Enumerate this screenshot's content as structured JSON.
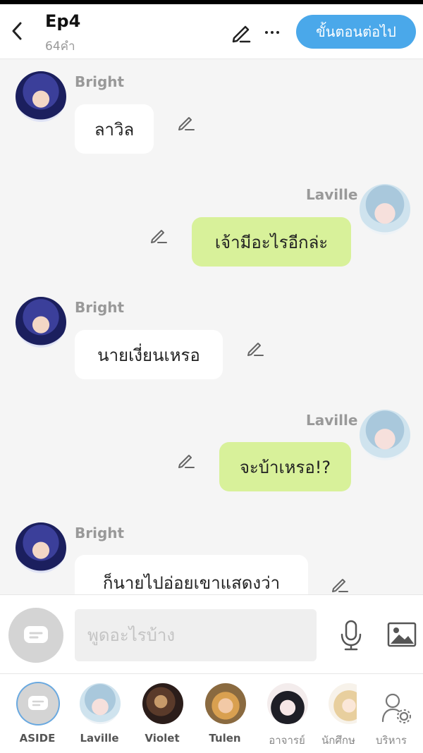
{
  "header": {
    "title": "Ep4",
    "word_count": "64คำ",
    "next_label": "ขั้นตอนต่อไป"
  },
  "messages": [
    {
      "side": "left",
      "sender": "Bright",
      "text": "ลาวิล"
    },
    {
      "side": "right",
      "sender": "Laville",
      "text": "เจ้ามีอะไรอีกล่ะ"
    },
    {
      "side": "left",
      "sender": "Bright",
      "text": "นายเงี่ยนเหรอ"
    },
    {
      "side": "right",
      "sender": "Laville",
      "text": "จะบ้าเหรอ!?"
    },
    {
      "side": "left",
      "sender": "Bright",
      "text": "ก็นายไปอ่อยเขาแสดงว่า"
    }
  ],
  "input": {
    "placeholder": "พูดอะไรบ้าง"
  },
  "characters": [
    {
      "name": "ASIDE",
      "active": true
    },
    {
      "name": "Laville"
    },
    {
      "name": "Violet"
    },
    {
      "name": "Tulen"
    },
    {
      "name": "อาจารย์"
    },
    {
      "name": "นักศึกษ"
    },
    {
      "name": "บริหาร"
    }
  ],
  "colors": {
    "accent": "#4aa8ea",
    "right_bubble": "#d8f19a",
    "left_bubble": "#ffffff",
    "background": "#f5f5f5"
  }
}
